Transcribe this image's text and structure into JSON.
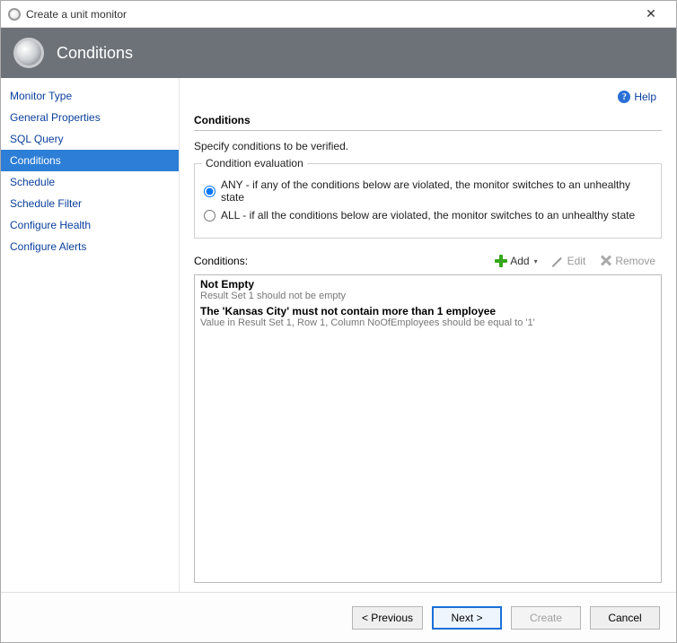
{
  "window": {
    "title": "Create a unit monitor",
    "close": "✕"
  },
  "header": {
    "title": "Conditions"
  },
  "help": {
    "label": "Help"
  },
  "sidebar": {
    "items": [
      {
        "label": "Monitor Type"
      },
      {
        "label": "General Properties"
      },
      {
        "label": "SQL Query"
      },
      {
        "label": "Conditions"
      },
      {
        "label": "Schedule"
      },
      {
        "label": "Schedule Filter"
      },
      {
        "label": "Configure Health"
      },
      {
        "label": "Configure Alerts"
      }
    ],
    "selected_index": 3
  },
  "main": {
    "section_title": "Conditions",
    "section_subtitle": "Specify conditions to be verified.",
    "fieldset_legend": "Condition evaluation",
    "radio_any": "ANY - if any of the conditions below are violated, the monitor switches to an unhealthy state",
    "radio_all": "ALL - if all the conditions below are violated, the monitor switches to an unhealthy state",
    "radio_selected": "any",
    "conditions_label": "Conditions:",
    "toolbar": {
      "add": "Add",
      "edit": "Edit",
      "remove": "Remove"
    },
    "conditions": [
      {
        "title": "Not Empty",
        "desc": "Result Set 1 should not be empty"
      },
      {
        "title": "The 'Kansas City' must not contain more than 1 employee",
        "desc": "Value in Result Set 1, Row 1, Column NoOfEmployees should be equal to '1'"
      }
    ]
  },
  "footer": {
    "previous": "< Previous",
    "next": "Next >",
    "create": "Create",
    "cancel": "Cancel"
  }
}
